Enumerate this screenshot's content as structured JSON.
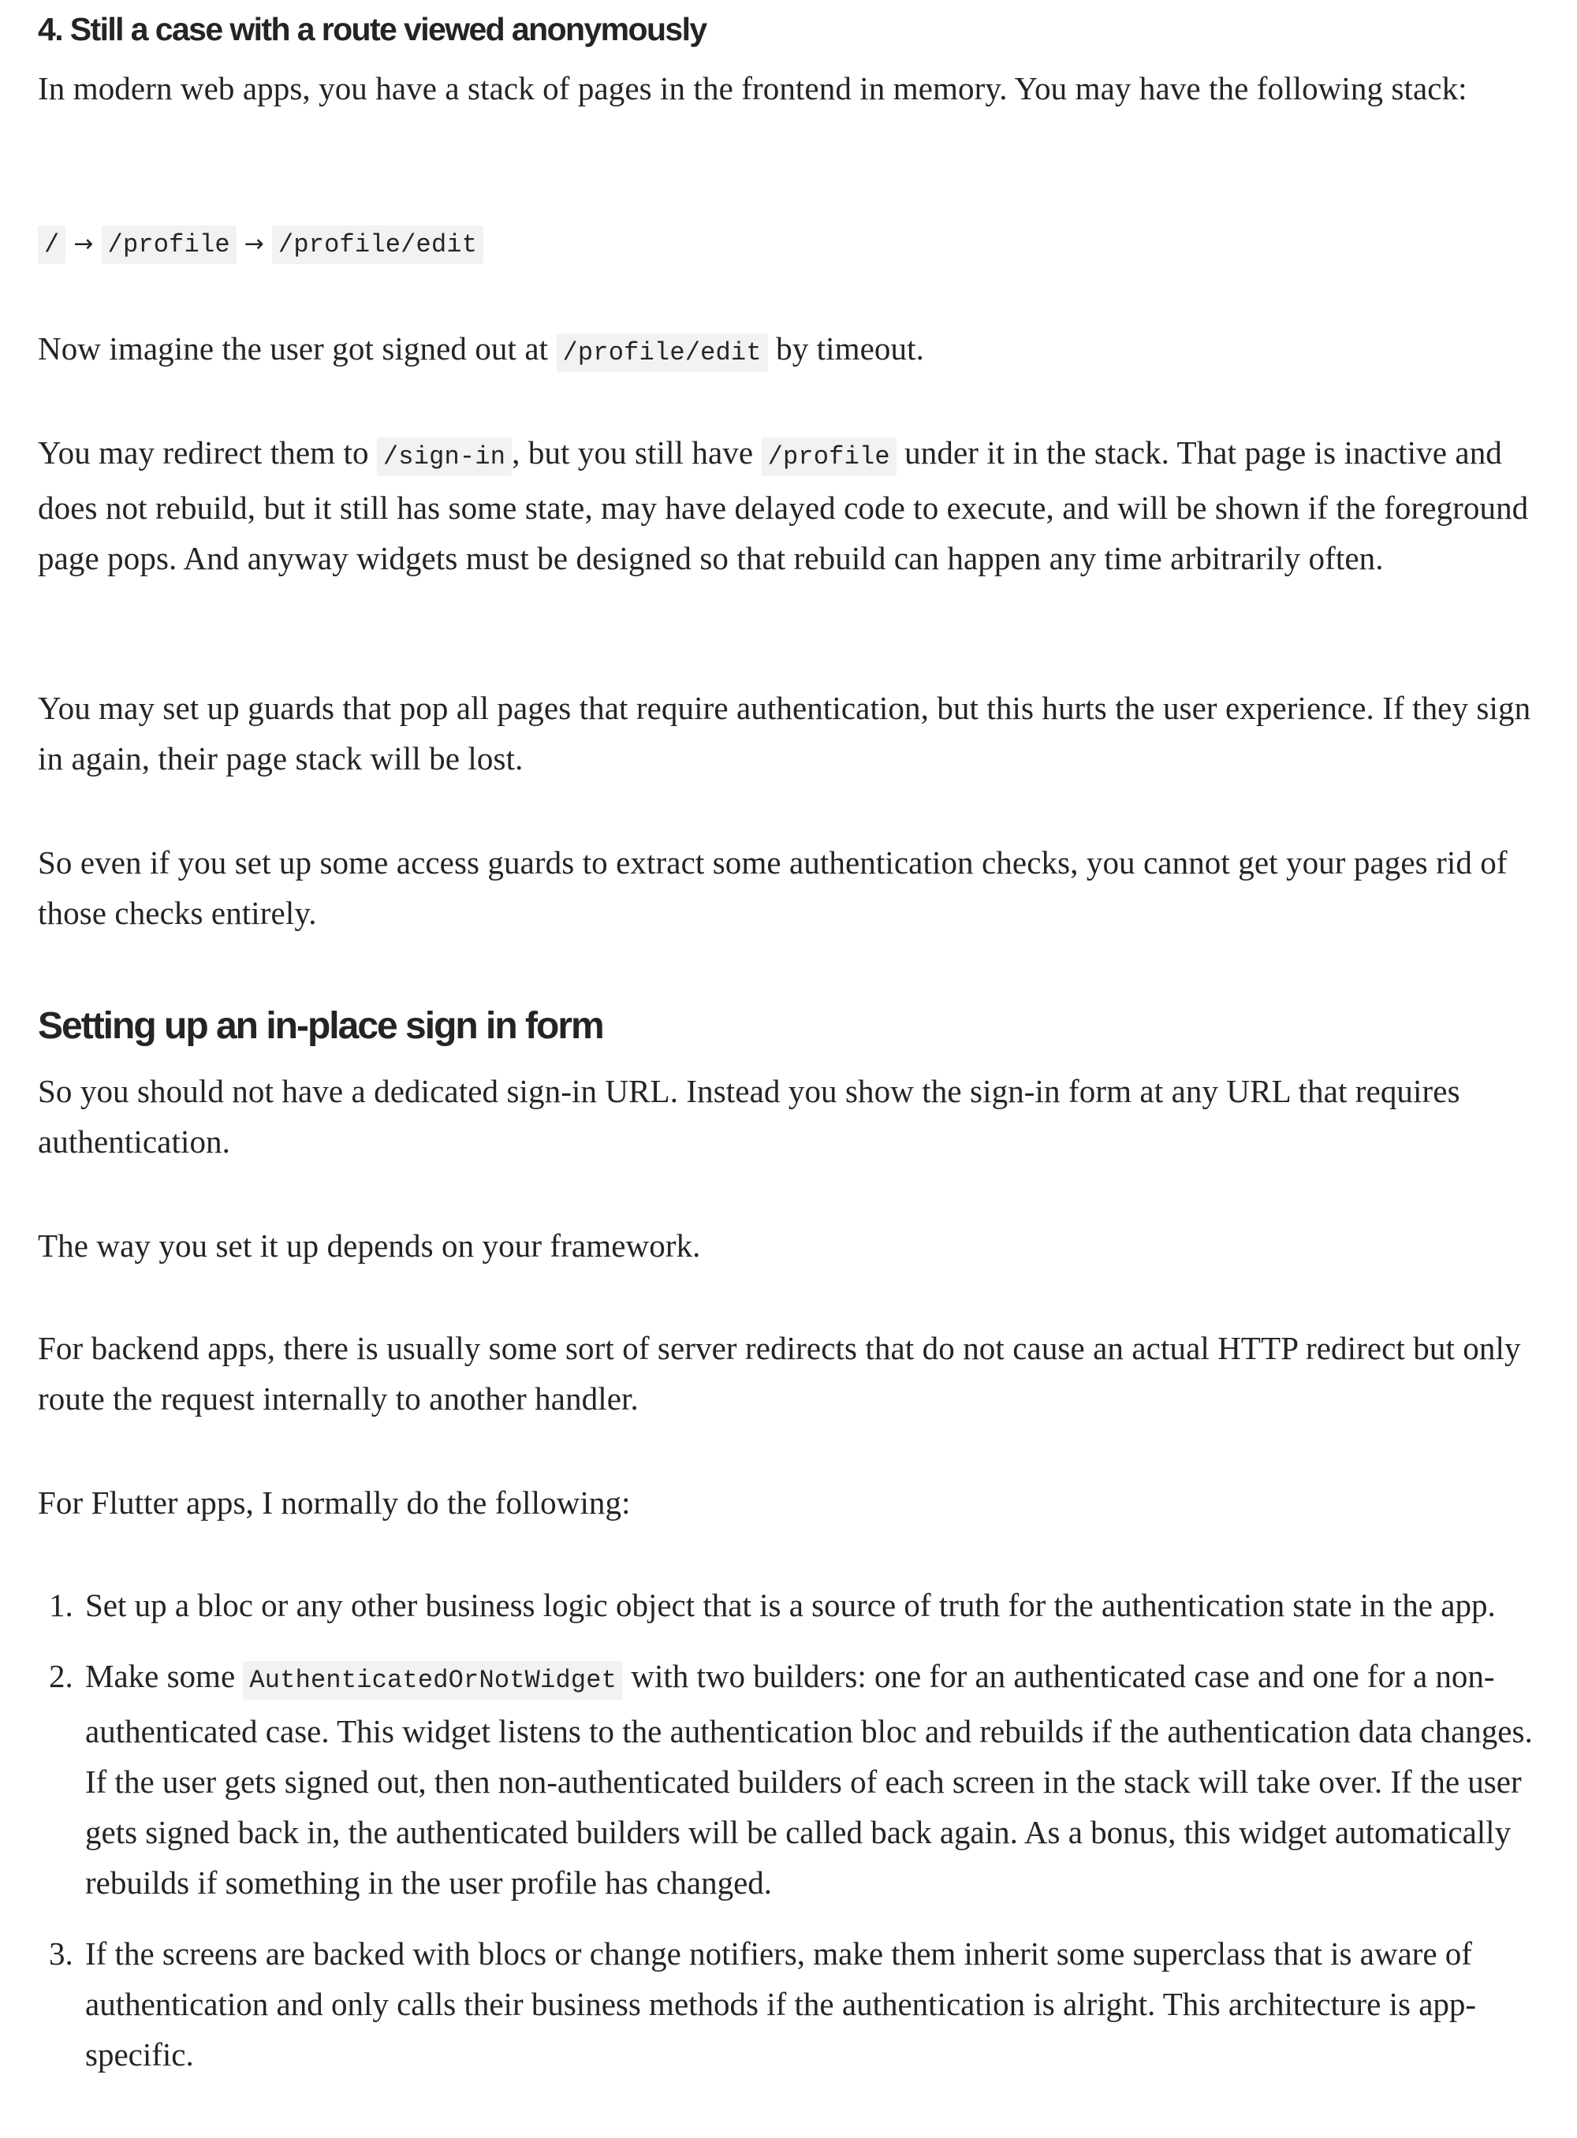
{
  "section4": {
    "heading": "4. Still a case with a route viewed anonymously",
    "intro": "In modern web apps, you have a stack of pages in the frontend in memory. You may have the following stack:",
    "route_stack": {
      "routes": [
        "/",
        "/profile",
        "/profile/edit"
      ],
      "separator": "→"
    },
    "p_timeout": {
      "before": "Now imagine the user got signed out at ",
      "code": "/profile/edit",
      "after": " by timeout."
    },
    "p_redirect": {
      "part1": "You may redirect them to ",
      "code1": "/sign-in",
      "part2": ", but you still have ",
      "code2": "/profile",
      "part3": " under it in the stack. That page is inactive and does not rebuild, but it still has some state, may have delayed code to execute, and will be shown if the foreground page pops. And anyway widgets must be designed so that rebuild can happen any time arbitrarily often."
    },
    "p_guards": "You may set up guards that pop all pages that require authentication, but this hurts the user experience. If they sign in again, their page stack will be lost.",
    "p_conclusion": "So even if you set up some access guards to extract some authentication checks, you cannot get your pages rid of those checks entirely."
  },
  "section_inplace": {
    "heading": "Setting up an in-place sign in form",
    "p1": "So you should not have a dedicated sign-in URL. Instead you show the sign-in form at any URL that requires authentication.",
    "p2": "The way you set it up depends on your framework.",
    "p3": "For backend apps, there is usually some sort of server redirects that do not cause an actual HTTP redirect but only route the request internally to another handler.",
    "p4": "For Flutter apps, I normally do the following:",
    "steps": [
      {
        "num": "1.",
        "text": "Set up a bloc or any other business logic object that is a source of truth for the authentication state in the app."
      },
      {
        "num": "2.",
        "before": "Make some ",
        "code": "AuthenticatedOrNotWidget",
        "after": " with two builders: one for an authenticated case and one for a non-authenticated case. This widget listens to the authentication bloc and rebuilds if the authentication data changes. If the user gets signed out, then non-authenticated builders of each screen in the stack will take over. If the user gets signed back in, the authenticated builders will be called back again. As a bonus, this widget automatically rebuilds if something in the user profile has changed."
      },
      {
        "num": "3.",
        "text": "If the screens are backed with blocs or change notifiers, make them inherit some superclass that is aware of authentication and only calls their business methods if the authentication is alright. This architecture is app-specific."
      }
    ]
  }
}
